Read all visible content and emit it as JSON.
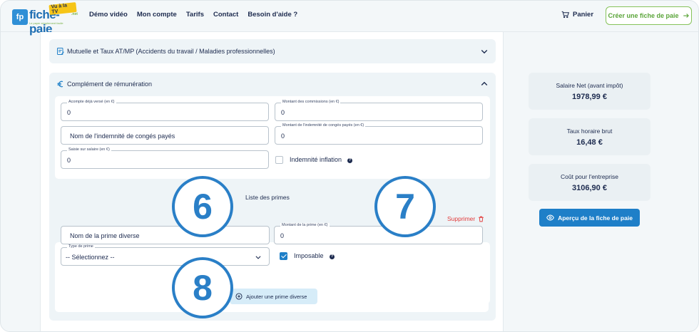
{
  "header": {
    "logo": {
      "badge": "fp",
      "name": "fiche-paie",
      "tv": "Vu à la TV",
      "net": ".net",
      "tagline": "Le payer simplement facile"
    },
    "nav": [
      "Démo vidéo",
      "Mon compte",
      "Tarifs",
      "Contact",
      "Besoin d'aide ?"
    ],
    "cart_label": "Panier",
    "cta_label": "Créer une fiche de paie"
  },
  "sections": {
    "mutuelle": {
      "title": "Mutuelle et Taux AT/MP (Accidents du travail / Maladies professionnelles)"
    },
    "complement": {
      "title": "Complément de rémunération",
      "fields": {
        "acompte": {
          "label": "Acompte déjà versé (en €)",
          "value": "0"
        },
        "commissions": {
          "label": "Montant des commissions (en €)",
          "value": "0"
        },
        "indemnite_nom": {
          "placeholder": "Nom de l'indemnité de congés payés"
        },
        "indemnite_montant": {
          "label": "Montant de l'indemnité de congés payés (en €)",
          "value": "0"
        },
        "saisie": {
          "label": "Saisie sur salaire (en €)",
          "value": "0"
        }
      },
      "inflation": {
        "label": "Indemnité inflation",
        "checked": false
      },
      "primes": {
        "list_title": "Liste des primes",
        "delete_label": "Supprimer",
        "prime_nom": {
          "placeholder": "Nom de la prime diverse"
        },
        "prime_montant": {
          "label": "Montant de la prime (en €)",
          "value": "0"
        },
        "prime_type": {
          "label": "Type de prime",
          "value": "-- Sélectionnez --"
        },
        "imposable": {
          "label": "Imposable",
          "checked": true
        },
        "add_label": "Ajouter une prime diverse"
      }
    }
  },
  "summary": [
    {
      "label": "Salaire Net (avant impôt)",
      "value": "1978,99 €"
    },
    {
      "label": "Taux horaire brut",
      "value": "16,48 €"
    },
    {
      "label": "Coût pour l'entreprise",
      "value": "3106,90 €"
    }
  ],
  "preview_label": "Aperçu de la fiche de paie",
  "markers": [
    "6",
    "7",
    "8"
  ],
  "colors": {
    "primary": "#1e7fc8",
    "accent_green": "#5ba53a",
    "danger": "#e23b3b",
    "panel": "#eef4f7"
  }
}
